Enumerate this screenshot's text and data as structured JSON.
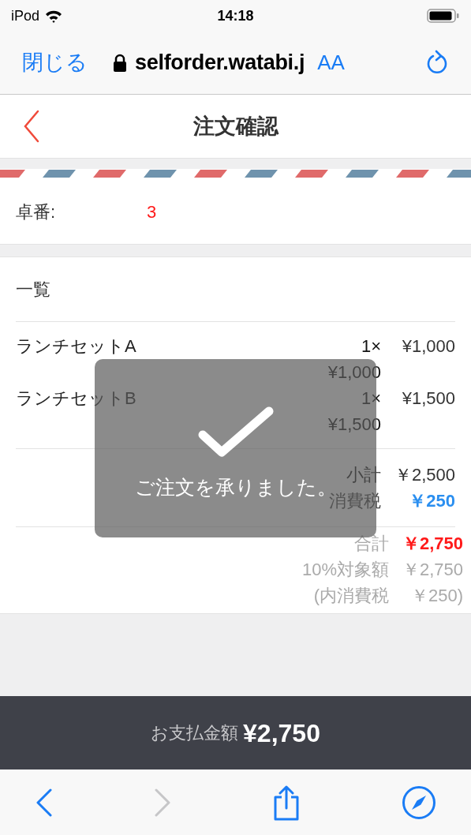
{
  "status_bar": {
    "device": "iPod",
    "time": "14:18"
  },
  "browser_bar": {
    "close": "閉じる",
    "url": "selforder.watabi.j",
    "text_size": "AA"
  },
  "header": {
    "title": "注文確認"
  },
  "table_number": {
    "label": "卓番:",
    "value": "3"
  },
  "order": {
    "heading": "一覧",
    "items": [
      {
        "name": "ランチセットA",
        "quantity": "1×",
        "price": "¥1,000",
        "amount": "¥1,000"
      },
      {
        "name": "ランチセットB",
        "quantity": "1×",
        "price": "¥1,500",
        "amount": "¥1,500"
      }
    ],
    "summary": [
      {
        "kind": "subtotal",
        "label": "小計",
        "value": "￥2,500"
      },
      {
        "kind": "tax",
        "label": "消費税",
        "value": "￥250"
      }
    ],
    "totals": [
      {
        "kind": "total",
        "label": "合計",
        "value": "￥2,750"
      },
      {
        "kind": "note",
        "label": "10%対象額",
        "value": "￥2,750"
      },
      {
        "kind": "note",
        "label": "(内消費税",
        "value": "￥250)"
      }
    ]
  },
  "toast": {
    "message": "ご注文を承りました。"
  },
  "payment_bar": {
    "label": "お支払金額",
    "amount": "¥2,750"
  },
  "toolbar": [
    {
      "kind": "back",
      "disabled": false
    },
    {
      "kind": "forward",
      "disabled": true
    },
    {
      "kind": "share",
      "disabled": false
    },
    {
      "kind": "compass",
      "disabled": false
    }
  ]
}
